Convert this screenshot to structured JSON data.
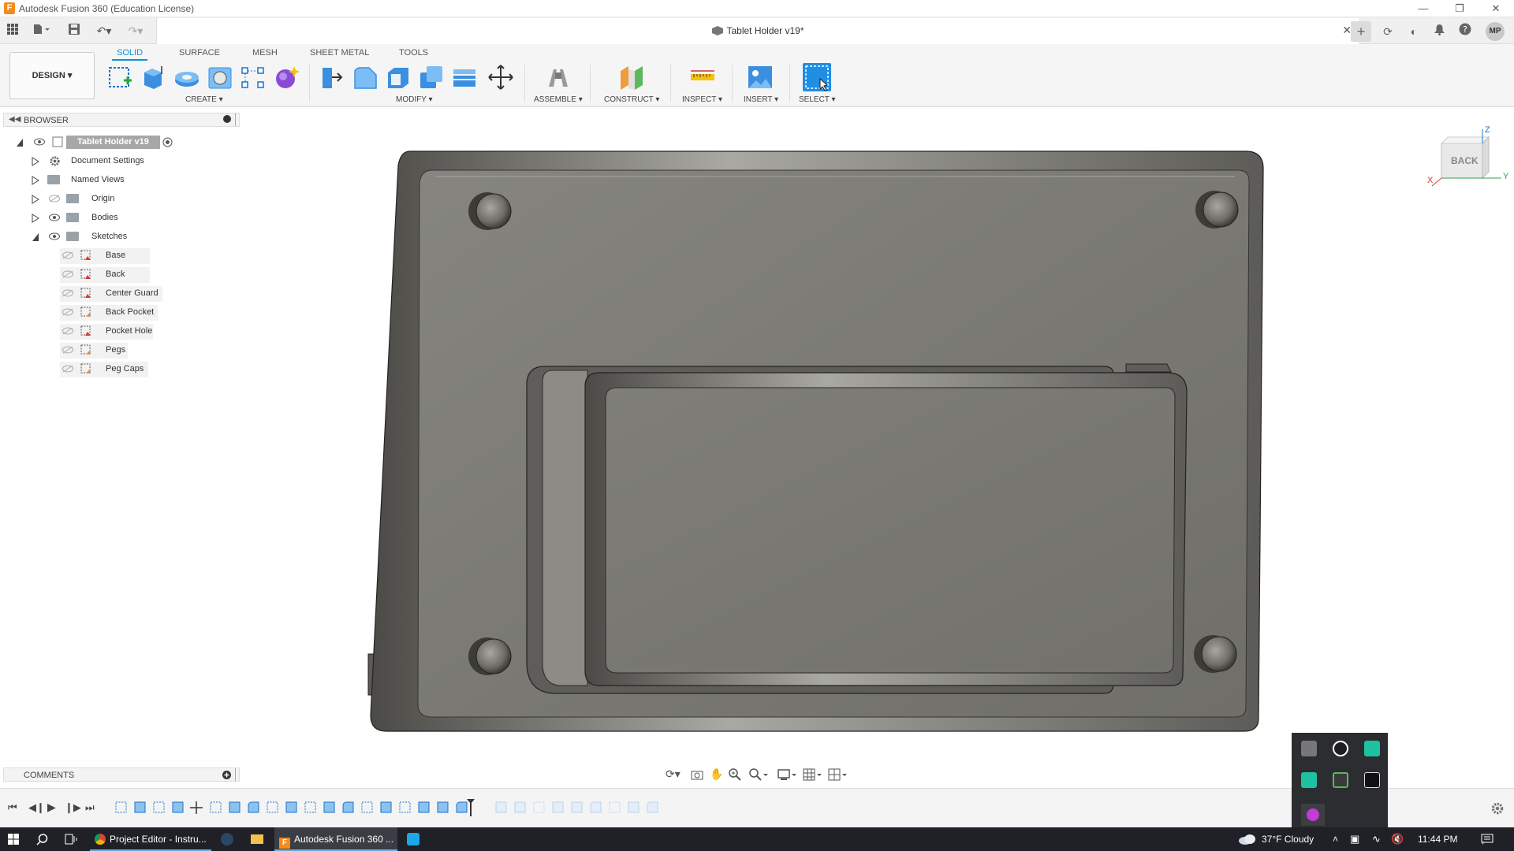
{
  "window": {
    "title": "Autodesk Fusion 360 (Education License)",
    "app_icon_letter": "F"
  },
  "document": {
    "title": "Tablet Holder v19*"
  },
  "user": {
    "initials": "MP"
  },
  "ribbon": {
    "workspace": "DESIGN",
    "tabs": [
      "SOLID",
      "SURFACE",
      "MESH",
      "SHEET METAL",
      "TOOLS"
    ],
    "active_tab": "SOLID",
    "groups": {
      "create": "CREATE",
      "modify": "MODIFY",
      "assemble": "ASSEMBLE",
      "construct": "CONSTRUCT",
      "inspect": "INSPECT",
      "insert": "INSERT",
      "select": "SELECT"
    }
  },
  "browser": {
    "header": "BROWSER",
    "root": "Tablet Holder v19",
    "items": [
      {
        "label": "Document Settings",
        "kind": "gear"
      },
      {
        "label": "Named Views",
        "kind": "folder"
      },
      {
        "label": "Origin",
        "kind": "folder"
      },
      {
        "label": "Bodies",
        "kind": "folder"
      },
      {
        "label": "Sketches",
        "kind": "folder"
      }
    ],
    "sketches": [
      "Base",
      "Back",
      "Center Guard",
      "Back Pocket",
      "Pocket Hole",
      "Pegs",
      "Peg Caps"
    ]
  },
  "comments": {
    "header": "COMMENTS"
  },
  "viewcube": {
    "face": "BACK",
    "axis_x": "X",
    "axis_y": "Y",
    "axis_z": "Z"
  },
  "taskbar": {
    "items": [
      {
        "label": "Project Editor - Instru..."
      },
      {
        "label": "Autodesk Fusion 360 ..."
      }
    ],
    "weather": "37°F  Cloudy",
    "time": "11:44 PM"
  },
  "colors": {
    "accent": "#0696d7",
    "model_face": "#7c7b75",
    "taskbar": "#1f2126"
  }
}
